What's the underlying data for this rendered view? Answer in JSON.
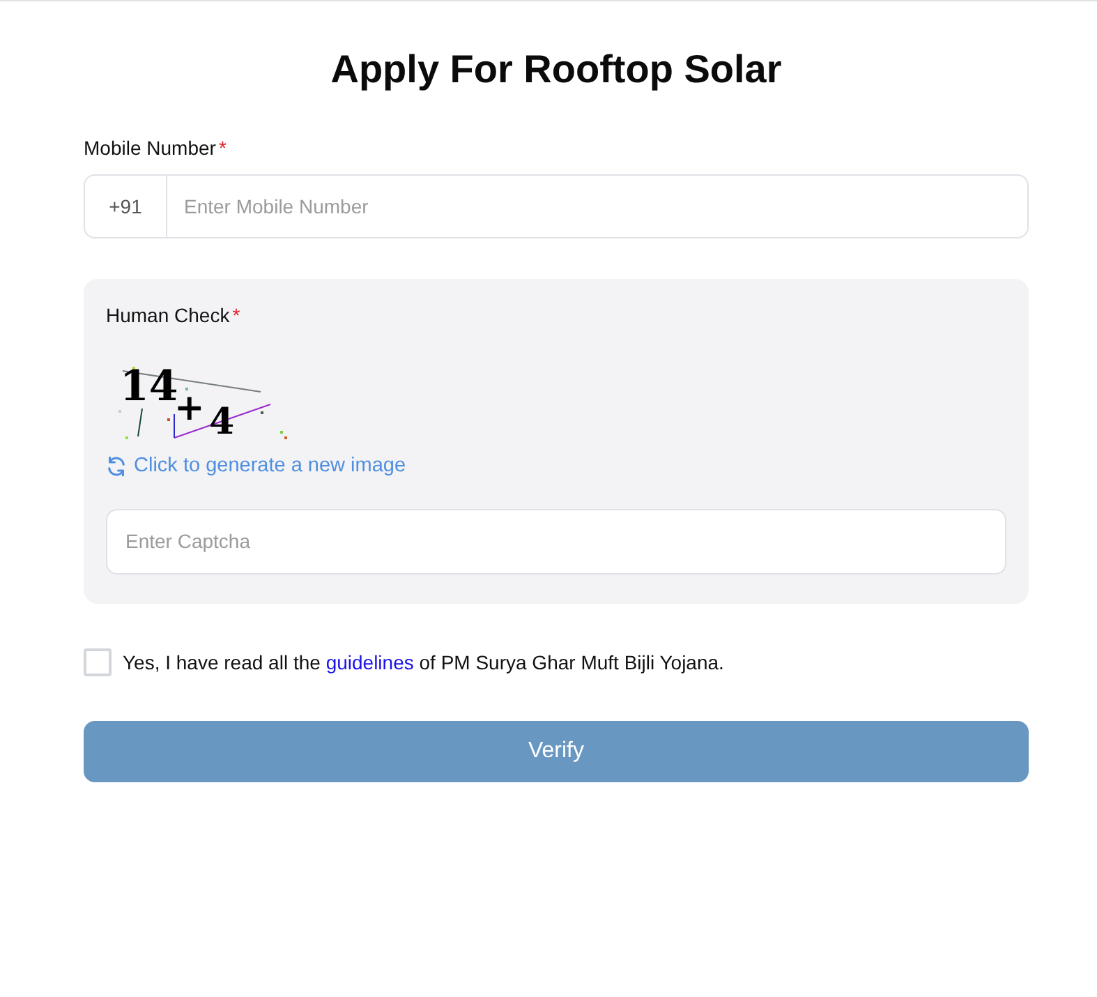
{
  "title": "Apply For Rooftop Solar",
  "mobile": {
    "label": "Mobile Number",
    "required_mark": "*",
    "prefix": "+91",
    "placeholder": "Enter Mobile Number"
  },
  "human_check": {
    "label": "Human Check",
    "required_mark": "*",
    "captcha": [
      "14",
      "+",
      "4"
    ],
    "refresh_link": "Click to generate a new image",
    "placeholder": "Enter Captcha"
  },
  "agreement": {
    "checked": false,
    "segments": [
      {
        "kind": "text",
        "text": "Yes, I have read all the"
      },
      {
        "kind": "link",
        "text": "guidelines"
      },
      {
        "kind": "text",
        "text": "of PM Surya Ghar Muft Bijli Yojana."
      }
    ]
  },
  "buttons": [
    {
      "label": "Verify",
      "disabled": true
    }
  ]
}
